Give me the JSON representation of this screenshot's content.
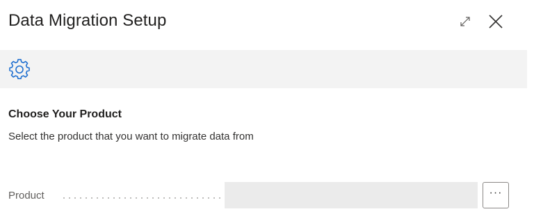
{
  "dialog": {
    "title": "Data Migration Setup",
    "expand_icon": "expand-icon",
    "close_icon": "close-icon"
  },
  "action_bar": {
    "settings_icon": "gear-icon",
    "accent_color": "#1f6fd0"
  },
  "section": {
    "heading": "Choose Your Product",
    "description": "Select the product that you want to migrate data from"
  },
  "product_field": {
    "label": "Product",
    "value": "",
    "lookup_label": "···"
  }
}
